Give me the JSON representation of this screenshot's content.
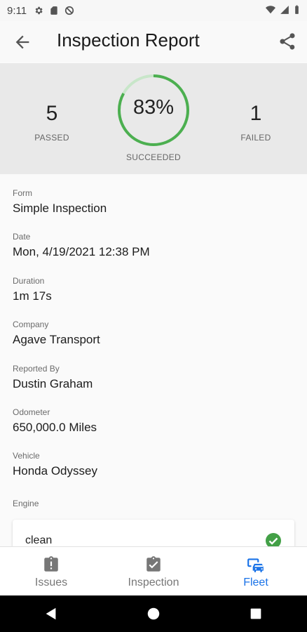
{
  "status_bar": {
    "time": "9:11",
    "left_icons": [
      "gear-icon",
      "sd-card-icon",
      "do-not-disturb-icon"
    ],
    "right_icons": [
      "wifi-icon",
      "signal-icon",
      "battery-icon"
    ]
  },
  "app_bar": {
    "title": "Inspection Report",
    "back_icon": "arrow-back-icon",
    "share_icon": "share-icon"
  },
  "summary": {
    "passed": {
      "value": "5",
      "label": "PASSED"
    },
    "failed": {
      "value": "1",
      "label": "FAILED"
    },
    "score": {
      "value": "83%",
      "label": "SUCCEEDED",
      "fraction": 0.83
    },
    "colors": {
      "progress": "#4caf50",
      "track": "#c8e6c9"
    }
  },
  "details": [
    {
      "label": "Form",
      "value": "Simple Inspection"
    },
    {
      "label": "Date",
      "value": "Mon, 4/19/2021 12:38 PM"
    },
    {
      "label": "Duration",
      "value": "1m 17s"
    },
    {
      "label": "Company",
      "value": "Agave Transport"
    },
    {
      "label": "Reported By",
      "value": "Dustin Graham"
    },
    {
      "label": "Odometer",
      "value": "650,000.0 Miles"
    },
    {
      "label": "Vehicle",
      "value": "Honda Odyssey"
    }
  ],
  "section": {
    "label": "Engine",
    "items": [
      {
        "label": "clean",
        "status_icon": "check-circle-icon",
        "status_color": "#43a047"
      }
    ]
  },
  "bottom_nav": {
    "items": [
      {
        "label": "Issues",
        "icon": "alert-clipboard-icon",
        "active": false
      },
      {
        "label": "Inspection",
        "icon": "check-clipboard-icon",
        "active": false
      },
      {
        "label": "Fleet",
        "icon": "vehicles-icon",
        "active": true
      }
    ],
    "active_color": "#1a73e8",
    "inactive_color": "#777777"
  },
  "system_nav": {
    "icons": [
      "back-triangle-icon",
      "home-circle-icon",
      "recents-square-icon"
    ]
  }
}
